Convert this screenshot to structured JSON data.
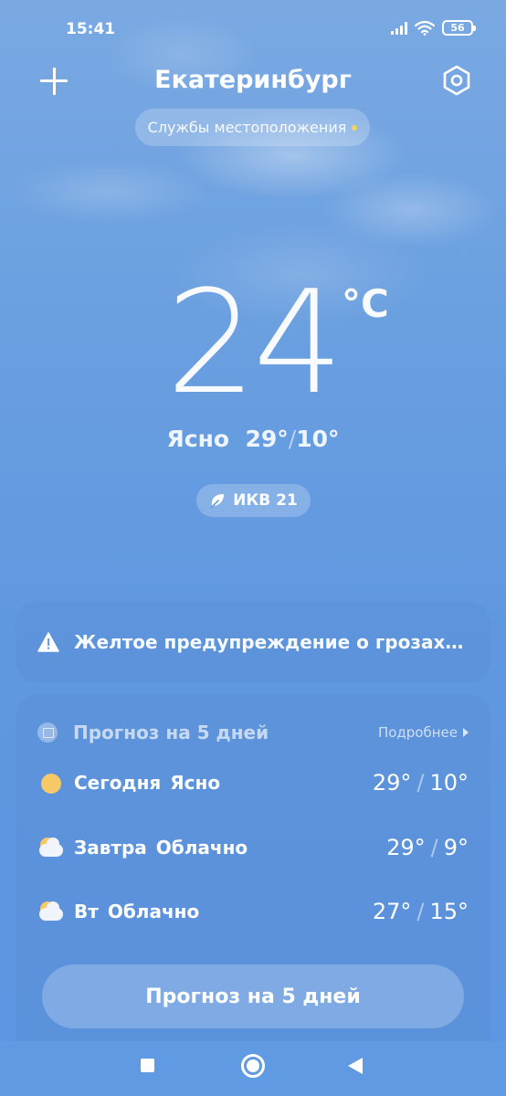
{
  "status_bar": {
    "time": "15:41",
    "battery": "56"
  },
  "header": {
    "city": "Екатеринбург",
    "location_services": "Службы местоположения"
  },
  "current": {
    "temperature": "24",
    "unit": "°C",
    "condition": "Ясно",
    "high": "29°",
    "low": "10°",
    "aqi_label": "ИКВ 21"
  },
  "alert": {
    "text": "Желтое предупреждение о грозах: Ж..."
  },
  "forecast": {
    "title": "Прогноз на 5 дней",
    "more_label": "Подробнее",
    "days": [
      {
        "day": "Сегодня",
        "condition": "Ясно",
        "high": "29°",
        "low": "10°",
        "icon": "sun-icon"
      },
      {
        "day": "Завтра",
        "condition": "Облачно",
        "high": "29°",
        "low": "9°",
        "icon": "partly-cloudy-icon"
      },
      {
        "day": "Вт",
        "condition": "Облачно",
        "high": "27°",
        "low": "15°",
        "icon": "partly-cloudy-icon"
      }
    ],
    "button_label": "Прогноз на 5 дней"
  },
  "colors": {
    "background": "#6a9fe0",
    "sun": "#f6c867",
    "location_dot": "#f7d35a"
  }
}
